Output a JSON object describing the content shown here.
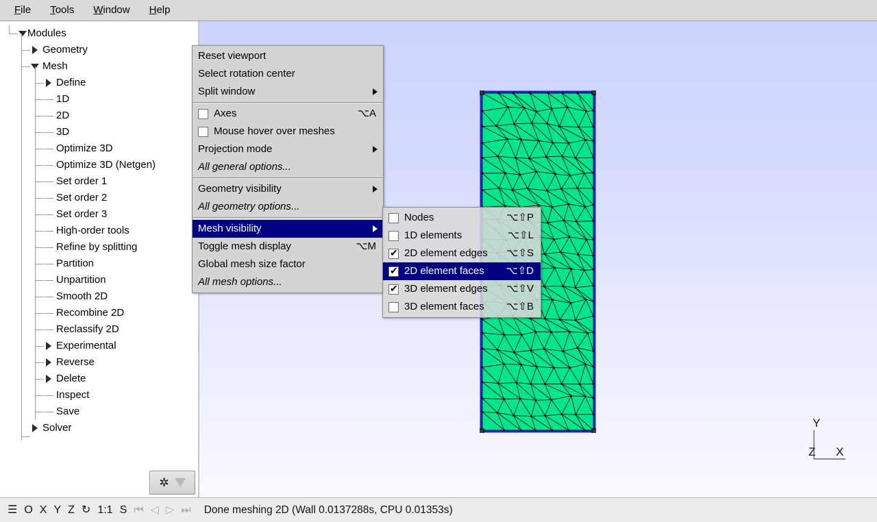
{
  "menubar": {
    "items": [
      {
        "mnemonic": "F",
        "rest": "ile",
        "name": "menu-file"
      },
      {
        "mnemonic": "T",
        "rest": "ools",
        "name": "menu-tools"
      },
      {
        "mnemonic": "W",
        "rest": "indow",
        "name": "menu-window"
      },
      {
        "mnemonic": "H",
        "rest": "elp",
        "name": "menu-help"
      }
    ]
  },
  "sidebar": {
    "tree": [
      {
        "label": "Modules",
        "level": 0,
        "knob": "tri-down"
      },
      {
        "label": "Geometry",
        "level": 1,
        "knob": "tri-right"
      },
      {
        "label": "Mesh",
        "level": 1,
        "knob": "tri-down"
      },
      {
        "label": "Define",
        "level": 2,
        "knob": "tri-right"
      },
      {
        "label": "1D",
        "level": 2,
        "knob": "dash"
      },
      {
        "label": "2D",
        "level": 2,
        "knob": "dash"
      },
      {
        "label": "3D",
        "level": 2,
        "knob": "dash"
      },
      {
        "label": "Optimize 3D",
        "level": 2,
        "knob": "dash"
      },
      {
        "label": "Optimize 3D (Netgen)",
        "level": 2,
        "knob": "dash"
      },
      {
        "label": "Set order 1",
        "level": 2,
        "knob": "dash"
      },
      {
        "label": "Set order 2",
        "level": 2,
        "knob": "dash"
      },
      {
        "label": "Set order 3",
        "level": 2,
        "knob": "dash"
      },
      {
        "label": "High-order tools",
        "level": 2,
        "knob": "dash"
      },
      {
        "label": "Refine by splitting",
        "level": 2,
        "knob": "dash"
      },
      {
        "label": "Partition",
        "level": 2,
        "knob": "dash"
      },
      {
        "label": "Unpartition",
        "level": 2,
        "knob": "dash"
      },
      {
        "label": "Smooth 2D",
        "level": 2,
        "knob": "dash"
      },
      {
        "label": "Recombine 2D",
        "level": 2,
        "knob": "dash"
      },
      {
        "label": "Reclassify 2D",
        "level": 2,
        "knob": "dash"
      },
      {
        "label": "Experimental",
        "level": 2,
        "knob": "tri-right"
      },
      {
        "label": "Reverse",
        "level": 2,
        "knob": "tri-right"
      },
      {
        "label": "Delete",
        "level": 2,
        "knob": "tri-right"
      },
      {
        "label": "Inspect",
        "level": 2,
        "knob": "dash"
      },
      {
        "label": "Save",
        "level": 2,
        "knob": "dash"
      },
      {
        "label": "Solver",
        "level": 1,
        "knob": "tri-right"
      }
    ],
    "options_button": {
      "icon": "gear-icon",
      "caret": "chevron-down-icon"
    }
  },
  "context_menu": {
    "items": [
      {
        "label": "Reset viewport",
        "type": "item"
      },
      {
        "label": "Select rotation center",
        "type": "item"
      },
      {
        "label": "Split window",
        "type": "submenu"
      },
      {
        "type": "separator"
      },
      {
        "label": "Axes",
        "type": "check",
        "checked": false,
        "accel": "⌥A"
      },
      {
        "label": "Mouse hover over meshes",
        "type": "check",
        "checked": false,
        "accel": ""
      },
      {
        "label": "Projection mode",
        "type": "submenu"
      },
      {
        "label": "All general options...",
        "type": "item",
        "italic": true
      },
      {
        "type": "separator"
      },
      {
        "label": "Geometry visibility",
        "type": "submenu"
      },
      {
        "label": "All geometry options...",
        "type": "item",
        "italic": true
      },
      {
        "type": "separator"
      },
      {
        "label": "Mesh visibility",
        "type": "submenu",
        "selected": true
      },
      {
        "label": "Toggle mesh display",
        "type": "item",
        "accel": "⌥M"
      },
      {
        "label": "Global mesh size factor",
        "type": "item"
      },
      {
        "label": "All mesh options...",
        "type": "item",
        "italic": true
      }
    ]
  },
  "submenu": {
    "items": [
      {
        "label": "Nodes",
        "checked": false,
        "accel": "⌥⇧P",
        "selected": false
      },
      {
        "label": "1D elements",
        "checked": false,
        "accel": "⌥⇧L",
        "selected": false
      },
      {
        "label": "2D element edges",
        "checked": true,
        "accel": "⌥⇧S",
        "selected": false
      },
      {
        "label": "2D element faces",
        "checked": true,
        "accel": "⌥⇧D",
        "selected": true
      },
      {
        "label": "3D element edges",
        "checked": true,
        "accel": "⌥⇧V",
        "selected": false
      },
      {
        "label": "3D element faces",
        "checked": false,
        "accel": "⌥⇧B",
        "selected": false
      }
    ]
  },
  "viewport": {
    "axes_indicator": {
      "y": "Y",
      "z": "Z",
      "x": "X"
    },
    "mesh": {
      "fill_color": "#00E68C",
      "edge_color": "#1a1a1a",
      "border_color": "#2222dd",
      "node_color": "#000000"
    },
    "background": {
      "top_color": "#ccd2fd",
      "bottom_color": "#f9f9ff"
    }
  },
  "statusbar": {
    "icons": [
      "☰",
      "O",
      "X",
      "Y",
      "Z",
      "↻"
    ],
    "scale": "1:1",
    "s_label": "S",
    "nav_icons": [
      "⏮",
      "◁",
      "▷",
      "⏭"
    ],
    "message": "Done meshing 2D (Wall 0.0137288s, CPU 0.01353s)"
  }
}
